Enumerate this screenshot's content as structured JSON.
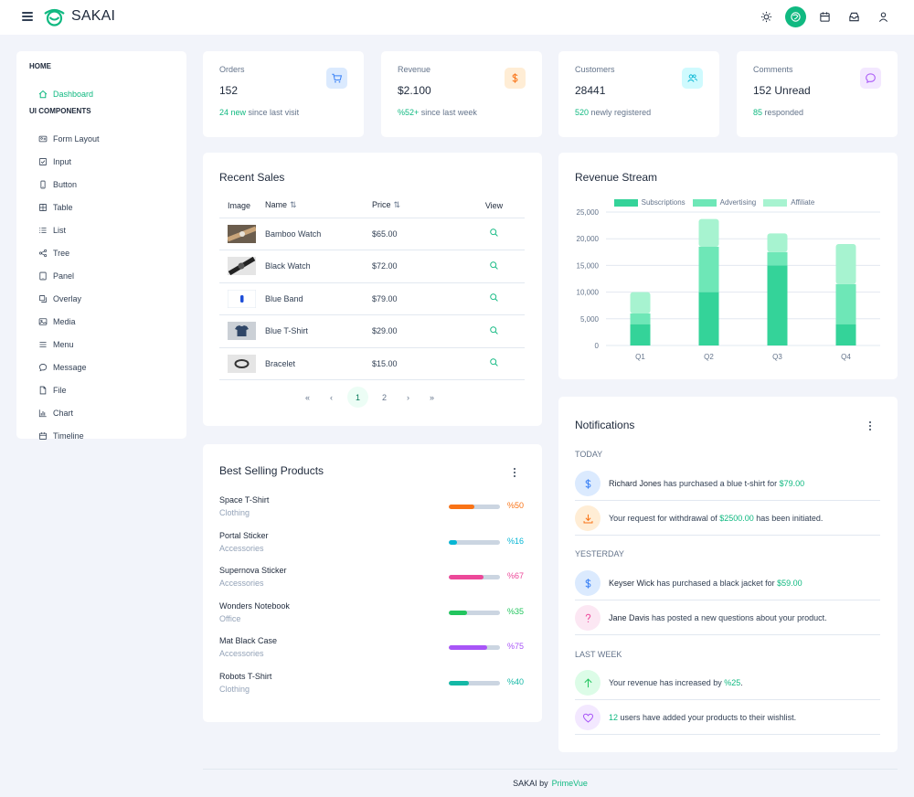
{
  "app": {
    "brand": "SAKAI"
  },
  "topbar": {
    "actions": [
      {
        "name": "theme-toggle-button",
        "icon": "sun-icon",
        "active": false
      },
      {
        "name": "palette-button",
        "icon": "palette-icon",
        "active": true
      },
      {
        "name": "calendar-button",
        "icon": "calendar-icon",
        "active": false
      },
      {
        "name": "inbox-button",
        "icon": "inbox-icon",
        "active": false
      },
      {
        "name": "profile-button",
        "icon": "user-icon",
        "active": false
      }
    ]
  },
  "sidebar": {
    "home_header": "HOME",
    "dashboard": {
      "label": "Dashboard",
      "icon": "home-icon"
    },
    "components_header": "UI COMPONENTS",
    "items": [
      {
        "label": "Form Layout",
        "icon": "id-card-icon"
      },
      {
        "label": "Input",
        "icon": "check-square-icon"
      },
      {
        "label": "Button",
        "icon": "mobile-icon"
      },
      {
        "label": "Table",
        "icon": "table-icon"
      },
      {
        "label": "List",
        "icon": "list-icon"
      },
      {
        "label": "Tree",
        "icon": "share-icon"
      },
      {
        "label": "Panel",
        "icon": "tablet-icon"
      },
      {
        "label": "Overlay",
        "icon": "clone-icon"
      },
      {
        "label": "Media",
        "icon": "image-icon"
      },
      {
        "label": "Menu",
        "icon": "bars-icon"
      },
      {
        "label": "Message",
        "icon": "comment-icon"
      },
      {
        "label": "File",
        "icon": "file-icon"
      },
      {
        "label": "Chart",
        "icon": "chart-bar-icon"
      },
      {
        "label": "Timeline",
        "icon": "calendar-icon"
      }
    ]
  },
  "stats": [
    {
      "label": "Orders",
      "value": "152",
      "highlight": "24 new",
      "sub": "since last visit",
      "icon": "shopping-cart-icon",
      "badge_bg": "#dbeafe",
      "badge_color": "#3b82f6"
    },
    {
      "label": "Revenue",
      "value": "$2.100",
      "highlight": "%52+",
      "sub": "since last week",
      "icon": "dollar-icon",
      "badge_bg": "#ffedd5",
      "badge_color": "#f97316"
    },
    {
      "label": "Customers",
      "value": "28441",
      "highlight": "520",
      "sub": "newly registered",
      "icon": "users-icon",
      "badge_bg": "#cffafe",
      "badge_color": "#06b6d4"
    },
    {
      "label": "Comments",
      "value": "152 Unread",
      "highlight": "85",
      "sub": "responded",
      "icon": "comment-icon",
      "badge_bg": "#f3e8ff",
      "badge_color": "#a855f7"
    }
  ],
  "recent_sales": {
    "title": "Recent Sales",
    "columns": {
      "image": "Image",
      "name": "Name",
      "price": "Price",
      "view": "View"
    },
    "rows": [
      {
        "name": "Bamboo Watch",
        "price": "$65.00",
        "thumb": "#8a7a66"
      },
      {
        "name": "Black Watch",
        "price": "$72.00",
        "thumb": "#3f3f3f"
      },
      {
        "name": "Blue Band",
        "price": "$79.00",
        "thumb": "#f8fafc"
      },
      {
        "name": "Blue T-Shirt",
        "price": "$29.00",
        "thumb": "#a3a8b0"
      },
      {
        "name": "Bracelet",
        "price": "$15.00",
        "thumb": "#d4d4d4"
      }
    ],
    "pager": {
      "pages": [
        "1",
        "2"
      ],
      "current": "1"
    }
  },
  "best_selling": {
    "title": "Best Selling Products",
    "items": [
      {
        "name": "Space T-Shirt",
        "category": "Clothing",
        "percent": 50,
        "label": "%50",
        "color": "#f97316"
      },
      {
        "name": "Portal Sticker",
        "category": "Accessories",
        "percent": 16,
        "label": "%16",
        "color": "#06b6d4"
      },
      {
        "name": "Supernova Sticker",
        "category": "Accessories",
        "percent": 67,
        "label": "%67",
        "color": "#ec4899"
      },
      {
        "name": "Wonders Notebook",
        "category": "Office",
        "percent": 35,
        "label": "%35",
        "color": "#22c55e"
      },
      {
        "name": "Mat Black Case",
        "category": "Accessories",
        "percent": 75,
        "label": "%75",
        "color": "#a855f7"
      },
      {
        "name": "Robots T-Shirt",
        "category": "Clothing",
        "percent": 40,
        "label": "%40",
        "color": "#14b8a6"
      }
    ]
  },
  "revenue_stream": {
    "title": "Revenue Stream"
  },
  "chart_data": {
    "type": "bar",
    "stacked": true,
    "categories": [
      "Q1",
      "Q2",
      "Q3",
      "Q4"
    ],
    "series": [
      {
        "name": "Subscriptions",
        "values": [
          4000,
          10000,
          15000,
          4000
        ],
        "color": "#34d399"
      },
      {
        "name": "Advertising",
        "values": [
          2000,
          8500,
          2500,
          7500
        ],
        "color": "#6ee7b7"
      },
      {
        "name": "Affiliate",
        "values": [
          4000,
          5200,
          3500,
          7500
        ],
        "color": "#a7f3d0"
      }
    ],
    "yticks": [
      "0",
      "5,000",
      "10,000",
      "15,000",
      "20,000",
      "25,000"
    ],
    "ylim": [
      0,
      25000
    ],
    "legend": "top",
    "grid": true
  },
  "notifications": {
    "title": "Notifications",
    "groups": [
      {
        "header": "TODAY",
        "items": [
          {
            "icon": "dollar-icon",
            "bg": "#dbeafe",
            "fg": "#3b82f6",
            "strong": "Richard Jones",
            "text": " has purchased a blue t-shirt for ",
            "hl": "$79.00",
            "after": ""
          },
          {
            "icon": "download-icon",
            "bg": "#ffedd5",
            "fg": "#f97316",
            "strong": "",
            "text": "Your request for withdrawal of ",
            "hl": "$2500.00",
            "after": " has been initiated."
          }
        ]
      },
      {
        "header": "YESTERDAY",
        "items": [
          {
            "icon": "dollar-icon",
            "bg": "#dbeafe",
            "fg": "#3b82f6",
            "strong": "Keyser Wick",
            "text": " has purchased a black jacket for ",
            "hl": "$59.00",
            "after": ""
          },
          {
            "icon": "question-icon",
            "bg": "#fce7f3",
            "fg": "#ec4899",
            "strong": "Jane Davis",
            "text": " has posted a new questions about your product.",
            "hl": "",
            "after": ""
          }
        ]
      },
      {
        "header": "LAST WEEK",
        "items": [
          {
            "icon": "arrow-up-icon",
            "bg": "#dcfce7",
            "fg": "#22c55e",
            "strong": "",
            "text": "Your revenue has increased by ",
            "hl": "%25",
            "after": "."
          },
          {
            "icon": "heart-icon",
            "bg": "#f3e8ff",
            "fg": "#a855f7",
            "strong": "",
            "hl_first": "12",
            "text": " users have added your products to their wishlist.",
            "hl": "",
            "after": ""
          }
        ]
      }
    ]
  },
  "footer": {
    "text": "SAKAI by",
    "link": "PrimeVue"
  }
}
